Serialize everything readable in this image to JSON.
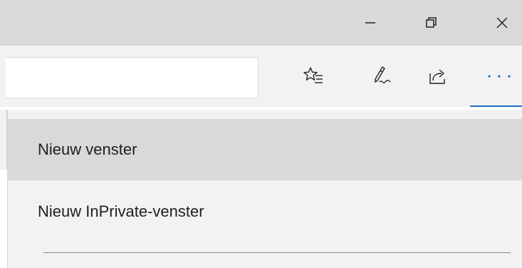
{
  "window_controls": {
    "minimize_icon": "minimize-icon",
    "restore_icon": "restore-icon",
    "close_icon": "close-icon"
  },
  "toolbar": {
    "address_value": "",
    "icons": [
      "favorites-icon",
      "web-notes-icon",
      "share-icon",
      "more-icon"
    ],
    "accent_color": "#1a73c8"
  },
  "menu": {
    "items": [
      {
        "label": "Nieuw venster"
      },
      {
        "label": "Nieuw InPrivate-venster"
      }
    ]
  }
}
